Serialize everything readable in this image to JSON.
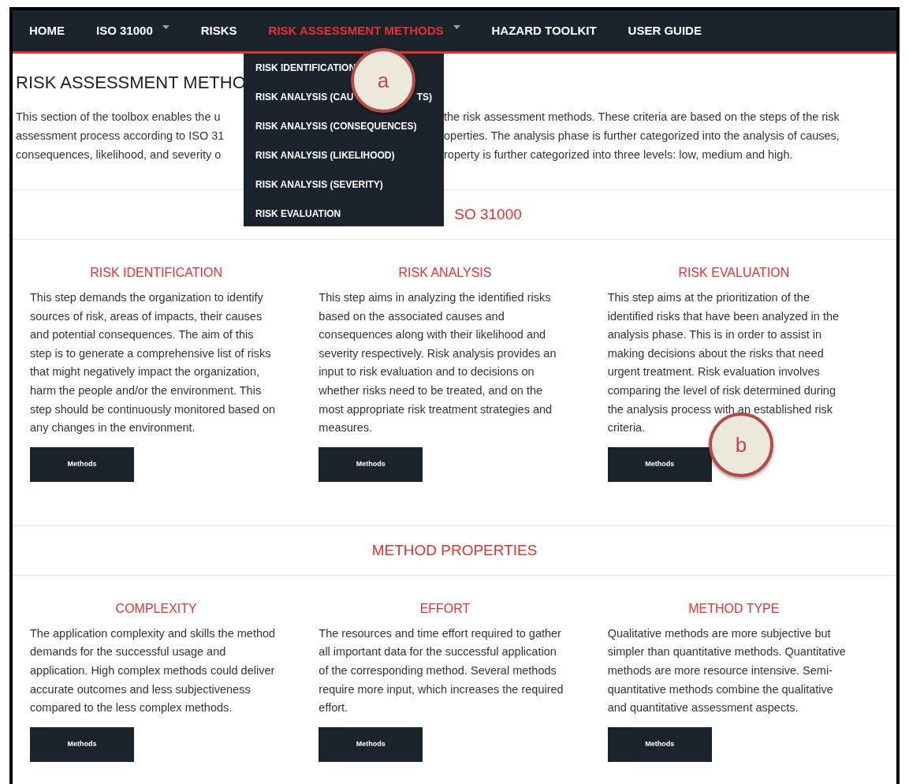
{
  "nav": {
    "items": [
      {
        "label": "HOME",
        "has_caret": false,
        "selected": false
      },
      {
        "label": "ISO 31000",
        "has_caret": true,
        "selected": false
      },
      {
        "label": "RISKS",
        "has_caret": false,
        "selected": false
      },
      {
        "label": "RISK ASSESSMENT METHODS",
        "has_caret": true,
        "selected": true
      },
      {
        "label": "HAZARD TOOLKIT",
        "has_caret": false,
        "selected": false
      },
      {
        "label": "USER GUIDE",
        "has_caret": false,
        "selected": false
      }
    ]
  },
  "dropdown": {
    "items": [
      {
        "label": "RISK IDENTIFICATION"
      },
      {
        "label": "RISK ANALYSIS (CAU",
        "label_end": "TS)"
      },
      {
        "label": "RISK ANALYSIS (CONSEQUENCES)"
      },
      {
        "label": "RISK ANALYSIS (LIKELIHOOD)"
      },
      {
        "label": "RISK ANALYSIS (SEVERITY)"
      },
      {
        "label": "RISK EVALUATION"
      }
    ]
  },
  "page_title": "RISK ASSESSMENT METHO",
  "intro_lines": [
    {
      "left": "This section of the toolbox enables the u",
      "right": "the risk assessment methods. These criteria are based on the steps of the risk"
    },
    {
      "left": "assessment process according to ISO 31",
      "right": "operties. The analysis phase is further categorized into the analysis of causes,"
    },
    {
      "left": "consequences, likelihood, and severity o",
      "right": "roperty is further categorized into three levels: low, medium and high."
    }
  ],
  "sections": [
    {
      "title": "SO 31000",
      "cards": [
        {
          "title": "RISK IDENTIFICATION",
          "text": "This step demands the organization to identify sources of risk, areas of impacts, their causes and potential consequences. The aim of this step is to generate a comprehensive list of risks that might negatively impact the organization, harm the people and/or the environment. This step should be continuously monitored based on any changes in the environment.",
          "button": "Methods"
        },
        {
          "title": "RISK ANALYSIS",
          "text": "This step aims in analyzing the identified risks based on the associated causes and consequences along with their likelihood and severity respectively. Risk analysis provides an input to risk evaluation and to decisions on whether risks need to be treated, and on the most appropriate risk treatment strategies and measures.",
          "button": "Methods"
        },
        {
          "title": "RISK EVALUATION",
          "text": "This step aims at the prioritization of the identified risks that have been analyzed in the analysis phase. This is in order to assist in making decisions about the risks that need urgent treatment. Risk evaluation involves comparing the level of risk determined during the analysis process with an established risk criteria.",
          "button": "Methods"
        }
      ]
    },
    {
      "title": "METHOD PROPERTIES",
      "cards": [
        {
          "title": "COMPLEXITY",
          "text": "The application complexity and skills the method demands for the successful usage and application. High complex methods could deliver accurate outcomes and less subjectiveness compared to the less complex methods.",
          "button": "Methods"
        },
        {
          "title": "EFFORT",
          "text": "The resources and time effort required to gather all important data for the successful application of the corresponding method. Several methods require more input, which increases the required effort.",
          "button": "Methods"
        },
        {
          "title": "METHOD TYPE",
          "text": "Qualitative methods are more subjective but simpler than quantitative methods. Quantitative methods are more resource intensive. Semi-quantitative methods combine the qualitative and quantitative assessment aspects.",
          "button": "Methods"
        }
      ]
    }
  ],
  "callouts": [
    {
      "label": "a"
    },
    {
      "label": "b"
    }
  ]
}
